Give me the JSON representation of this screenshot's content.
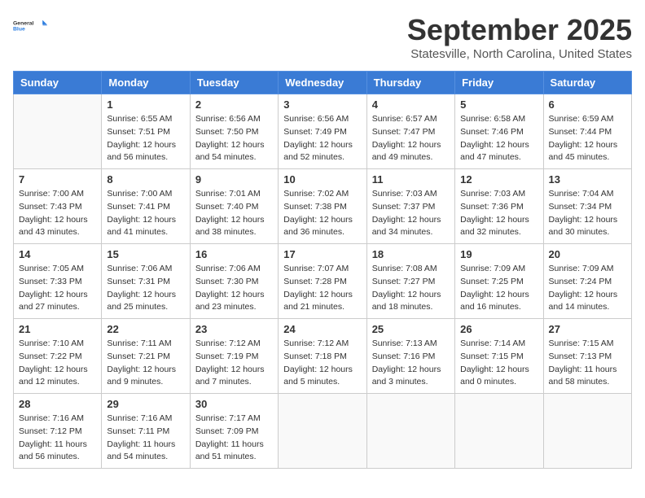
{
  "logo": {
    "general": "General",
    "blue": "Blue"
  },
  "title": "September 2025",
  "location": "Statesville, North Carolina, United States",
  "headers": [
    "Sunday",
    "Monday",
    "Tuesday",
    "Wednesday",
    "Thursday",
    "Friday",
    "Saturday"
  ],
  "weeks": [
    [
      {
        "day": "",
        "info": ""
      },
      {
        "day": "1",
        "info": "Sunrise: 6:55 AM\nSunset: 7:51 PM\nDaylight: 12 hours\nand 56 minutes."
      },
      {
        "day": "2",
        "info": "Sunrise: 6:56 AM\nSunset: 7:50 PM\nDaylight: 12 hours\nand 54 minutes."
      },
      {
        "day": "3",
        "info": "Sunrise: 6:56 AM\nSunset: 7:49 PM\nDaylight: 12 hours\nand 52 minutes."
      },
      {
        "day": "4",
        "info": "Sunrise: 6:57 AM\nSunset: 7:47 PM\nDaylight: 12 hours\nand 49 minutes."
      },
      {
        "day": "5",
        "info": "Sunrise: 6:58 AM\nSunset: 7:46 PM\nDaylight: 12 hours\nand 47 minutes."
      },
      {
        "day": "6",
        "info": "Sunrise: 6:59 AM\nSunset: 7:44 PM\nDaylight: 12 hours\nand 45 minutes."
      }
    ],
    [
      {
        "day": "7",
        "info": "Sunrise: 7:00 AM\nSunset: 7:43 PM\nDaylight: 12 hours\nand 43 minutes."
      },
      {
        "day": "8",
        "info": "Sunrise: 7:00 AM\nSunset: 7:41 PM\nDaylight: 12 hours\nand 41 minutes."
      },
      {
        "day": "9",
        "info": "Sunrise: 7:01 AM\nSunset: 7:40 PM\nDaylight: 12 hours\nand 38 minutes."
      },
      {
        "day": "10",
        "info": "Sunrise: 7:02 AM\nSunset: 7:38 PM\nDaylight: 12 hours\nand 36 minutes."
      },
      {
        "day": "11",
        "info": "Sunrise: 7:03 AM\nSunset: 7:37 PM\nDaylight: 12 hours\nand 34 minutes."
      },
      {
        "day": "12",
        "info": "Sunrise: 7:03 AM\nSunset: 7:36 PM\nDaylight: 12 hours\nand 32 minutes."
      },
      {
        "day": "13",
        "info": "Sunrise: 7:04 AM\nSunset: 7:34 PM\nDaylight: 12 hours\nand 30 minutes."
      }
    ],
    [
      {
        "day": "14",
        "info": "Sunrise: 7:05 AM\nSunset: 7:33 PM\nDaylight: 12 hours\nand 27 minutes."
      },
      {
        "day": "15",
        "info": "Sunrise: 7:06 AM\nSunset: 7:31 PM\nDaylight: 12 hours\nand 25 minutes."
      },
      {
        "day": "16",
        "info": "Sunrise: 7:06 AM\nSunset: 7:30 PM\nDaylight: 12 hours\nand 23 minutes."
      },
      {
        "day": "17",
        "info": "Sunrise: 7:07 AM\nSunset: 7:28 PM\nDaylight: 12 hours\nand 21 minutes."
      },
      {
        "day": "18",
        "info": "Sunrise: 7:08 AM\nSunset: 7:27 PM\nDaylight: 12 hours\nand 18 minutes."
      },
      {
        "day": "19",
        "info": "Sunrise: 7:09 AM\nSunset: 7:25 PM\nDaylight: 12 hours\nand 16 minutes."
      },
      {
        "day": "20",
        "info": "Sunrise: 7:09 AM\nSunset: 7:24 PM\nDaylight: 12 hours\nand 14 minutes."
      }
    ],
    [
      {
        "day": "21",
        "info": "Sunrise: 7:10 AM\nSunset: 7:22 PM\nDaylight: 12 hours\nand 12 minutes."
      },
      {
        "day": "22",
        "info": "Sunrise: 7:11 AM\nSunset: 7:21 PM\nDaylight: 12 hours\nand 9 minutes."
      },
      {
        "day": "23",
        "info": "Sunrise: 7:12 AM\nSunset: 7:19 PM\nDaylight: 12 hours\nand 7 minutes."
      },
      {
        "day": "24",
        "info": "Sunrise: 7:12 AM\nSunset: 7:18 PM\nDaylight: 12 hours\nand 5 minutes."
      },
      {
        "day": "25",
        "info": "Sunrise: 7:13 AM\nSunset: 7:16 PM\nDaylight: 12 hours\nand 3 minutes."
      },
      {
        "day": "26",
        "info": "Sunrise: 7:14 AM\nSunset: 7:15 PM\nDaylight: 12 hours\nand 0 minutes."
      },
      {
        "day": "27",
        "info": "Sunrise: 7:15 AM\nSunset: 7:13 PM\nDaylight: 11 hours\nand 58 minutes."
      }
    ],
    [
      {
        "day": "28",
        "info": "Sunrise: 7:16 AM\nSunset: 7:12 PM\nDaylight: 11 hours\nand 56 minutes."
      },
      {
        "day": "29",
        "info": "Sunrise: 7:16 AM\nSunset: 7:11 PM\nDaylight: 11 hours\nand 54 minutes."
      },
      {
        "day": "30",
        "info": "Sunrise: 7:17 AM\nSunset: 7:09 PM\nDaylight: 11 hours\nand 51 minutes."
      },
      {
        "day": "",
        "info": ""
      },
      {
        "day": "",
        "info": ""
      },
      {
        "day": "",
        "info": ""
      },
      {
        "day": "",
        "info": ""
      }
    ]
  ]
}
